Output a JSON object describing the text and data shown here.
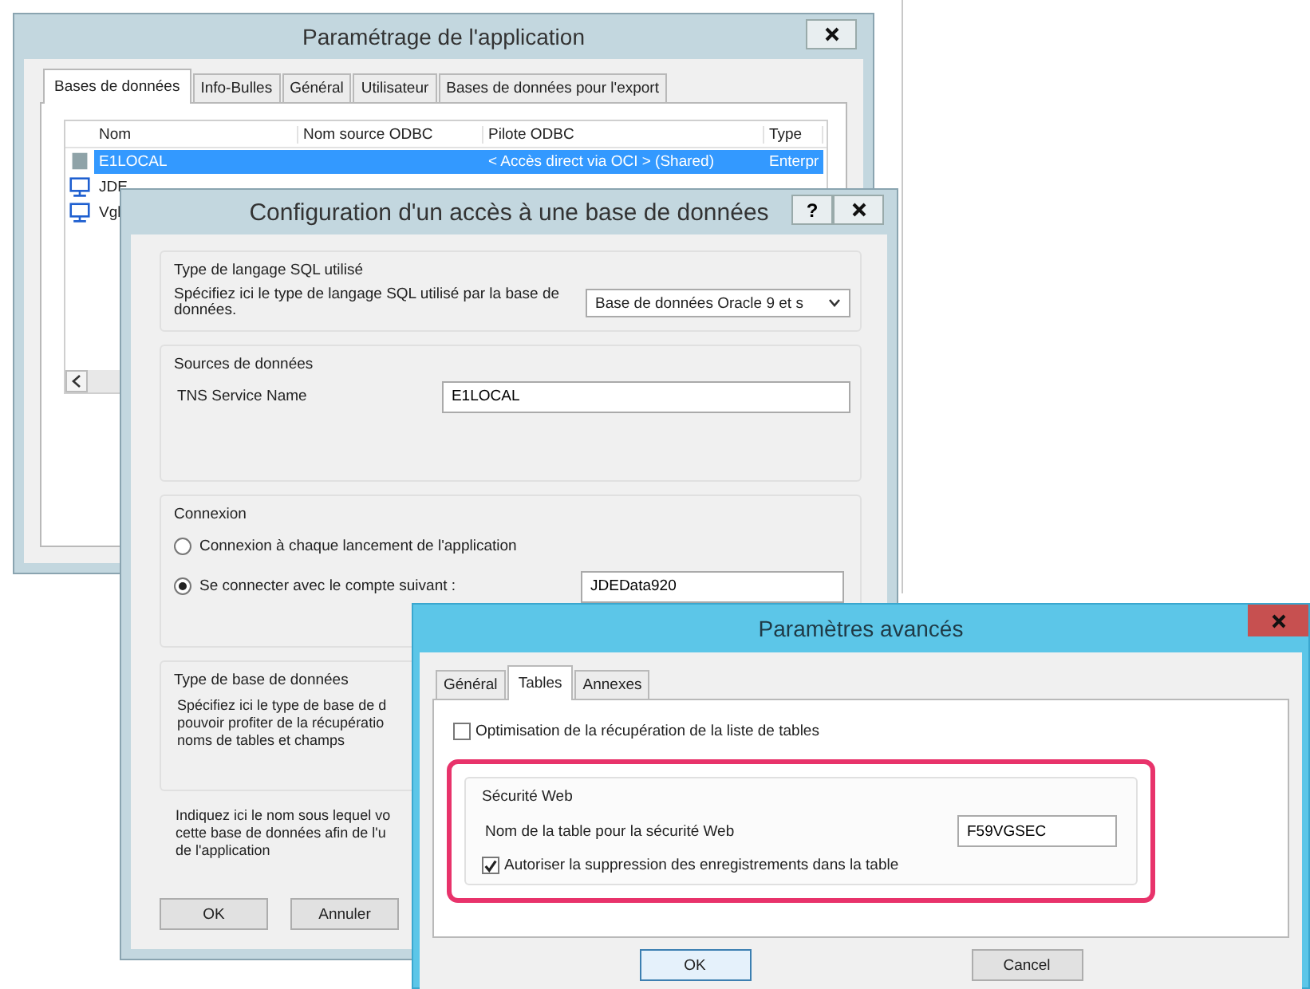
{
  "app_settings_window": {
    "title": "Paramétrage de l'application",
    "tabs": [
      {
        "label": "Bases de données",
        "selected": true
      },
      {
        "label": "Info-Bulles",
        "selected": false
      },
      {
        "label": "Général",
        "selected": false
      },
      {
        "label": "Utilisateur",
        "selected": false
      },
      {
        "label": "Bases de données pour l'export",
        "selected": false
      }
    ],
    "list": {
      "columns": [
        "Nom",
        "Nom source ODBC",
        "Pilote ODBC",
        "Type"
      ],
      "rows": [
        {
          "kind": "database",
          "cells": [
            "E1LOCAL",
            "",
            "< Accès direct via OCI > (Shared)",
            "Enterpr"
          ],
          "selected": true
        },
        {
          "kind": "computer",
          "cells": [
            "JDE"
          ],
          "selected": false
        },
        {
          "kind": "computer",
          "cells": [
            "Vgl"
          ],
          "selected": false
        }
      ]
    }
  },
  "db_config_dialog": {
    "title": "Configuration d'un accès à une base de données",
    "help_button": "?",
    "sql_section": {
      "legend": "Type de langage SQL utilisé",
      "description": "Spécifiez ici le type de langage SQL utilisé par la base de données.",
      "dropdown_value": "Base de données Oracle 9 et s"
    },
    "sources_section": {
      "legend": "Sources de données",
      "label": "TNS Service Name",
      "value": "E1LOCAL"
    },
    "connection_section": {
      "legend": "Connexion",
      "options": [
        {
          "label": "Connexion à chaque lancement de l'application",
          "selected": false
        },
        {
          "label": "Se connecter avec le compte suivant :",
          "selected": true
        }
      ],
      "account_value": "JDEData920"
    },
    "db_type_section": {
      "legend": "Type de base de données",
      "lines": [
        "Spécifiez ici le type de base de d",
        "pouvoir profiter de la récupératio",
        "noms de tables et champs"
      ]
    },
    "note_lines": [
      "Indiquez ici le nom sous lequel vo",
      "cette base de données afin de l'u",
      "de l'application"
    ],
    "buttons": [
      "OK",
      "Annuler"
    ]
  },
  "advanced_dialog": {
    "title": "Paramètres avancés",
    "tabs": [
      {
        "label": "Général",
        "selected": false
      },
      {
        "label": "Tables",
        "selected": true
      },
      {
        "label": "Annexes",
        "selected": false
      }
    ],
    "optimisation": {
      "label": "Optimisation de la récupération de la liste de tables",
      "checked": false
    },
    "web_security": {
      "legend": "Sécurité Web",
      "highlighted": true,
      "table_label": "Nom de la table pour la sécurité Web",
      "table_value": "F59VGSEC",
      "delete": {
        "label": "Autoriser la suppression des enregistrements dans la table",
        "checked": true
      }
    },
    "buttons": [
      "OK",
      "Cancel"
    ]
  }
}
